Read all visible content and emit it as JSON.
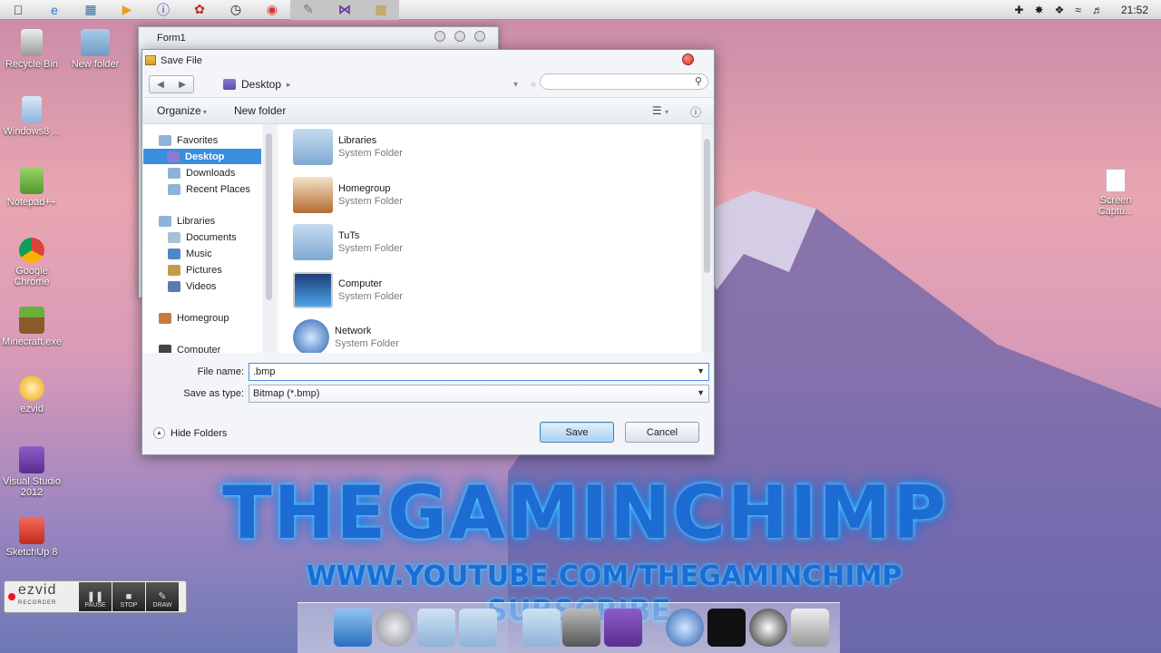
{
  "colors": {
    "accent": "#3a8fdc",
    "brand_glow": "#1fa4ff"
  },
  "topbar": {
    "apps": [
      "apple-icon",
      "ie-icon",
      "notepad-icon",
      "media-icon",
      "info-icon",
      "paint-icon",
      "clock-icon",
      "chrome-icon",
      "notes-icon",
      "visual-studio-icon",
      "forms-icon"
    ],
    "tray_icons": [
      "plus-icon",
      "pin-icon",
      "dropbox-icon",
      "wifi-icon",
      "volume-icon"
    ],
    "clock": "21:52"
  },
  "desktop_icons": [
    "Recycle Bin",
    "New folder",
    "Windows8 ...",
    "Notepad++",
    "Google Chrome",
    "Minecraft.exe",
    "ezvid",
    "Visual Studio 2012",
    "SketchUp 8"
  ],
  "screen_capture_icon": "Screen Captu...",
  "form1": {
    "title": "Form1"
  },
  "dialog": {
    "title": "Save File",
    "breadcrumb": "Desktop",
    "search_placeholder": "",
    "toolbar": {
      "organize": "Organize",
      "new_folder": "New folder"
    },
    "nav": {
      "favorites": "Favorites",
      "desktop": "Desktop",
      "downloads": "Downloads",
      "recent": "Recent Places",
      "libraries": "Libraries",
      "documents": "Documents",
      "music": "Music",
      "pictures": "Pictures",
      "videos": "Videos",
      "homegroup": "Homegroup",
      "computer": "Computer"
    },
    "items": [
      {
        "name": "Libraries",
        "type": "System Folder"
      },
      {
        "name": "Homegroup",
        "type": "System Folder"
      },
      {
        "name": "TuTs",
        "type": "System Folder"
      },
      {
        "name": "Computer",
        "type": "System Folder"
      },
      {
        "name": "Network",
        "type": "System Folder"
      }
    ],
    "file_name_label": "File name:",
    "file_name_value": ".bmp",
    "save_type_label": "Save as type:",
    "save_type_value": "Bitmap  (*.bmp)",
    "hide_folders": "Hide Folders",
    "save": "Save",
    "cancel": "Cancel"
  },
  "overlay": {
    "brand": "THEGAMINCHIMP",
    "url": "WWW.YOUTUBE.COM/THEGAMINCHIMP",
    "subscribe": "SUBSCRIBE"
  },
  "ezvid": {
    "logo": "ezvid",
    "sub": "RECORDER",
    "pause": "PAUSE",
    "stop": "STOP",
    "draw": "DRAW"
  }
}
